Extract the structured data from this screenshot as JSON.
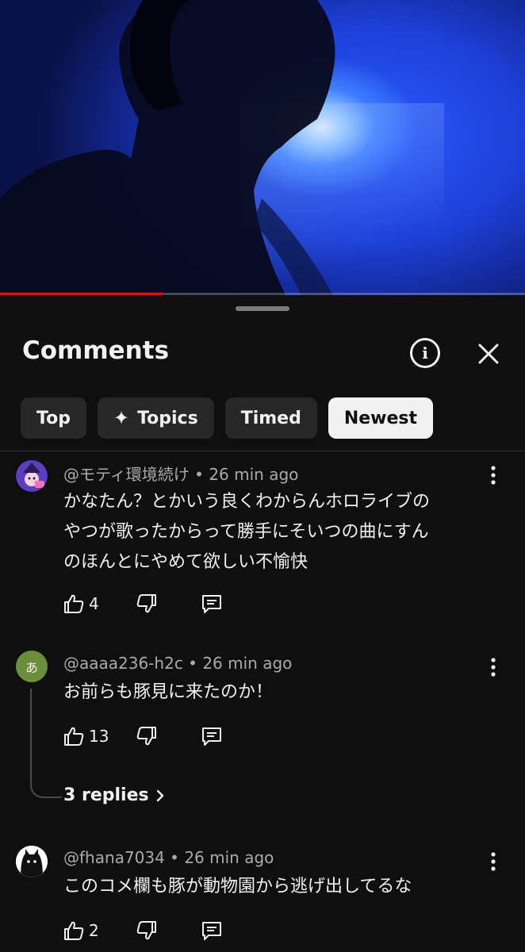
{
  "video": {
    "progress_fraction": 0.31
  },
  "panel": {
    "title": "Comments"
  },
  "chips": [
    {
      "label": "Top",
      "icon": null
    },
    {
      "label": "Topics",
      "icon": "sparkle-icon"
    },
    {
      "label": "Timed",
      "icon": null
    },
    {
      "label": "Newest",
      "icon": null
    }
  ],
  "comments": [
    {
      "author": "@モティ環境続け",
      "time": "26 min ago",
      "text_lines": [
        "かなたん？とかいう良くわからんホロライブの",
        "やつが歌ったからって勝手にそいつの曲にすん",
        "のほんとにやめて欲しい不愉快"
      ],
      "likes": "4",
      "avatar_color": "#5a3fc2"
    },
    {
      "author": "@aaaa236-h2c",
      "time": "26 min ago",
      "text_lines": [
        "お前らも豚見に来たのか！"
      ],
      "likes": "13",
      "avatar_letter": "あ",
      "avatar_color": "#6b8e3a",
      "replies_label": "3 replies"
    },
    {
      "author": "@fhana7034",
      "time": "26 min ago",
      "text_lines": [
        "このコメ欄も豚が動物園から逃げ出してるな"
      ],
      "likes": "2",
      "avatar_color": "#ffffff"
    }
  ]
}
